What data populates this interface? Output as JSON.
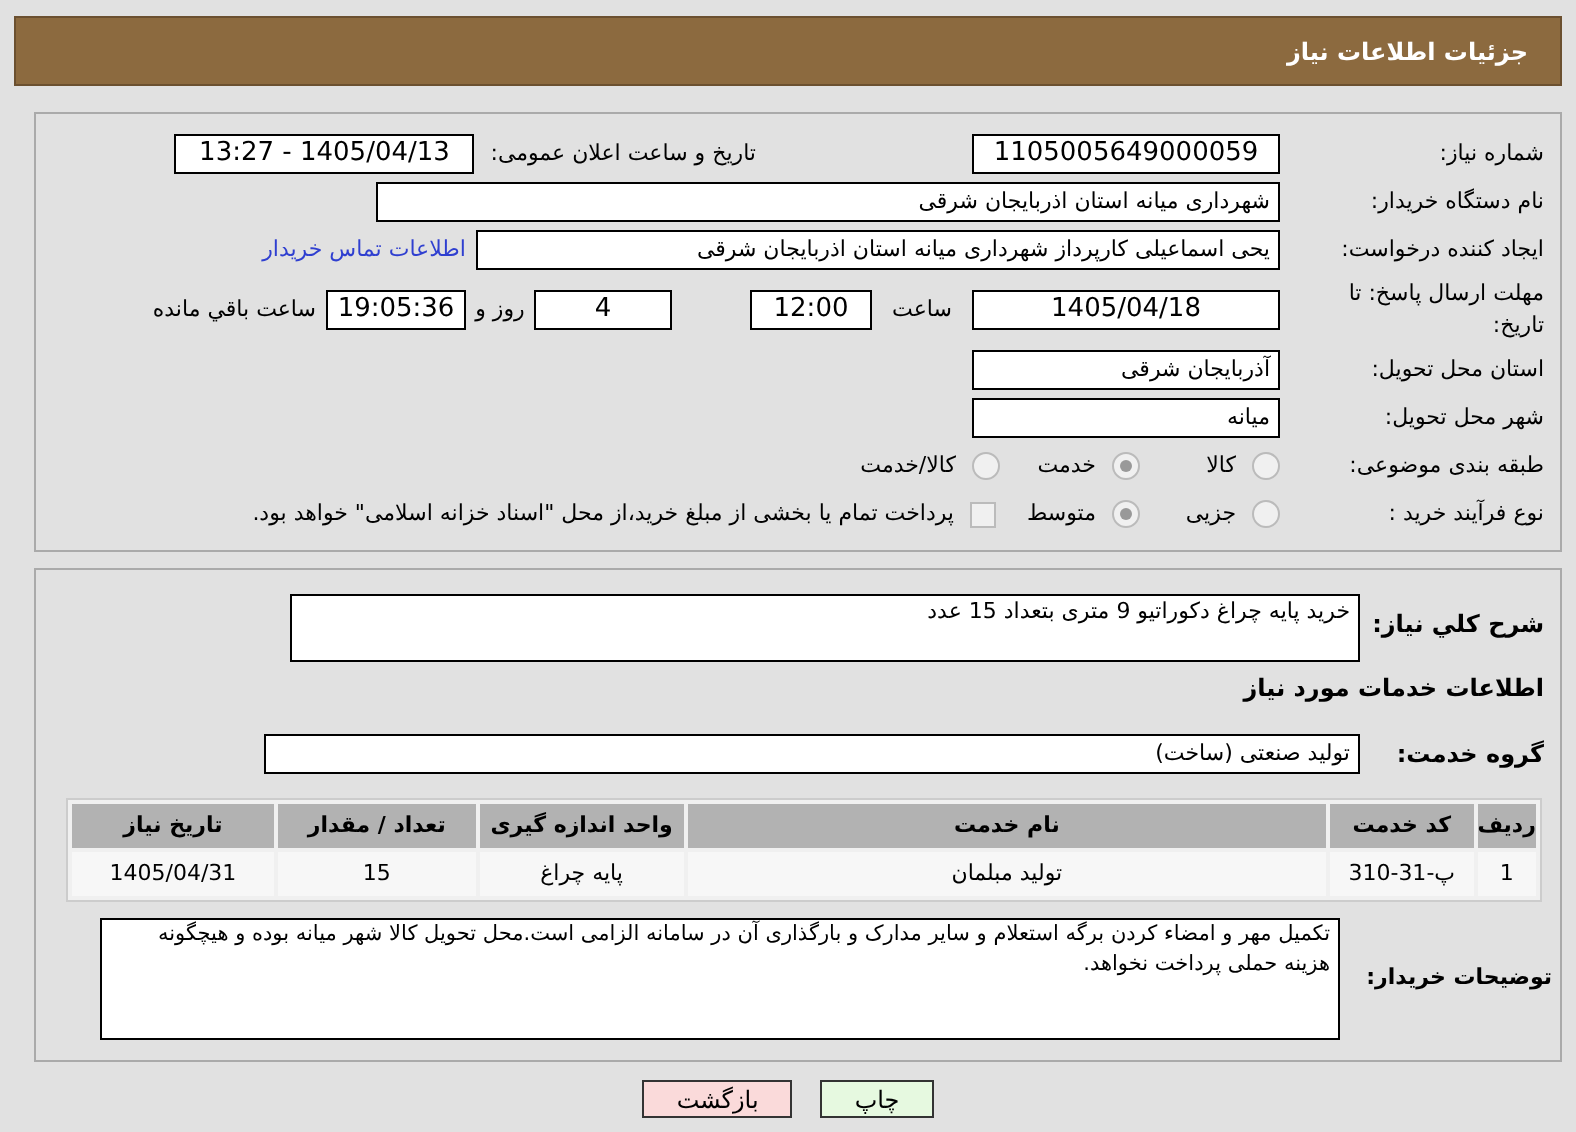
{
  "header": {
    "title": "جزئیات اطلاعات نیاز"
  },
  "details": {
    "need_number": {
      "label": "شماره نیاز:",
      "value": "1105005649000059"
    },
    "announce": {
      "label": "تاریخ و ساعت اعلان عمومی:",
      "value": "1405/04/13 - 13:27"
    },
    "buyer_org": {
      "label": "نام دستگاه خریدار:",
      "value": "شهرداری میانه استان اذربایجان شرقی"
    },
    "requester": {
      "label": "ایجاد کننده درخواست:",
      "value": "یحی اسماعیلی  کارپرداز شهرداری میانه استان اذربایجان شرقی",
      "link": "اطلاعات تماس خریدار"
    },
    "deadline": {
      "label": "مهلت ارسال پاسخ: تا تاریخ:",
      "date": "1405/04/18",
      "time_label": "ساعت",
      "time": "12:00",
      "days": "4",
      "days_label": "روز و",
      "remaining": "19:05:36",
      "remaining_label": "ساعت باقي مانده"
    },
    "province": {
      "label": "استان محل تحویل:",
      "value": "آذربایجان شرقی"
    },
    "city": {
      "label": "شهر محل تحویل:",
      "value": "میانه"
    },
    "category": {
      "label": "طبقه بندی موضوعی:",
      "options": [
        {
          "label": "کالا",
          "selected": false
        },
        {
          "label": "خدمت",
          "selected": true
        },
        {
          "label": "کالا/خدمت",
          "selected": false
        }
      ]
    },
    "process": {
      "label": "نوع فرآیند خرید :",
      "options": [
        {
          "label": "جزیی",
          "selected": false
        },
        {
          "label": "متوسط",
          "selected": true
        }
      ],
      "payment": {
        "checked": false,
        "text": "پرداخت تمام یا بخشی از مبلغ خرید،از محل \"اسناد خزانه اسلامی\" خواهد بود."
      }
    }
  },
  "summary": {
    "label": "شرح کلي نياز:",
    "value": "خرید پایه چراغ دکوراتیو 9 متری بتعداد 15 عدد"
  },
  "services": {
    "title": "اطلاعات خدمات مورد نیاز",
    "group_label": "گروه خدمت:",
    "group_value": "تولید صنعتی (ساخت)",
    "columns": [
      "ردیف",
      "کد خدمت",
      "نام خدمت",
      "واحد اندازه گیری",
      "تعداد / مقدار",
      "تاریخ نیاز"
    ],
    "rows": [
      [
        "1",
        "پ-31-310",
        "تولید مبلمان",
        "پایه چراغ",
        "15",
        "1405/04/31"
      ]
    ]
  },
  "notes": {
    "label": "توضیحات خریدار:",
    "value": "تکمیل مهر و امضاء کردن برگه استعلام و سایر مدارک و بارگذاری آن در سامانه الزامی است.محل تحویل کالا شهر میانه بوده و هیچگونه هزینه حملی پرداخت نخواهد."
  },
  "buttons": [
    {
      "label": "چاپ",
      "kind": "print"
    },
    {
      "label": "بازگشت",
      "kind": "back"
    }
  ]
}
